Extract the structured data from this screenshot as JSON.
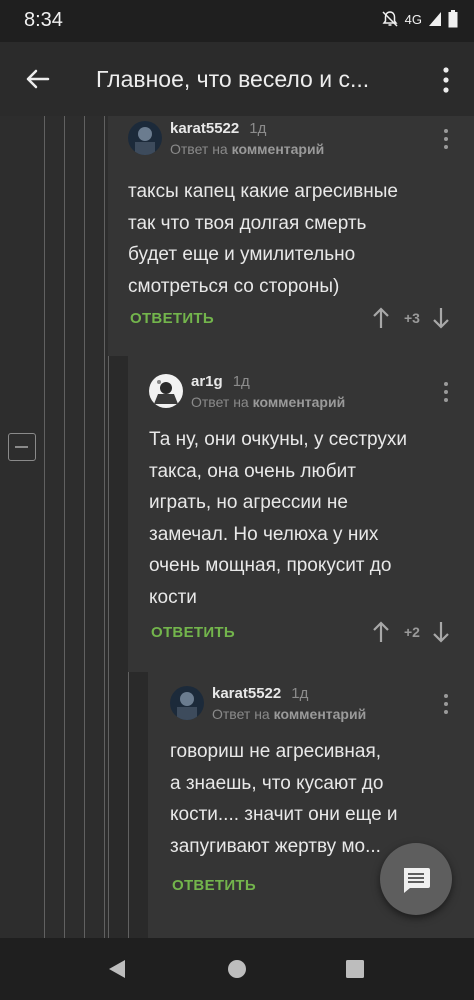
{
  "status_bar": {
    "time": "8:34",
    "network": "4G"
  },
  "app_bar": {
    "title": "Главное, что весело и с..."
  },
  "comments": [
    {
      "author": "karat5522",
      "time": "1д",
      "reply_prefix": "Ответ на",
      "reply_target": "комментарий",
      "text": [
        "таксы капец какие агресивные",
        "так что твоя долгая смерть",
        "будет еще и умилительно",
        "смотреться со стороны)"
      ],
      "reply_label": "ОТВЕТИТЬ",
      "votes": "+3"
    },
    {
      "author": "ar1g",
      "time": "1д",
      "reply_prefix": "Ответ на",
      "reply_target": "комментарий",
      "text": [
        "Та ну, они очкуны, у сеструхи",
        "такса, она очень любит",
        "играть, но агрессии не",
        "замечал. Но челюха у них",
        "очень мощная, прокусит до",
        "кости"
      ],
      "reply_label": "ОТВЕТИТЬ",
      "votes": "+2"
    },
    {
      "author": "karat5522",
      "time": "1д",
      "reply_prefix": "Ответ на",
      "reply_target": "комментарий",
      "text": [
        "говориш не агресивная,",
        "а знаешь, что кусают до",
        "кости.... значит они еще и",
        "запугивают жертву мо..."
      ],
      "reply_label": "ОТВЕТИТЬ"
    }
  ]
}
